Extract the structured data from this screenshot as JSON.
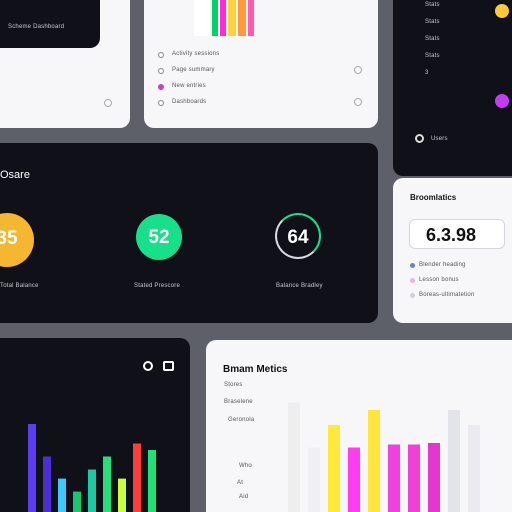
{
  "top_left_card": {
    "caption": "Scheme Dashboard"
  },
  "top_middle_card": {
    "bar_colors": [
      "#ffffff",
      "#00d26a",
      "#ff2bd6",
      "#ffd23c",
      "#ff9a3c",
      "#ff5ab0"
    ],
    "rows": [
      {
        "label": "Activity sessions",
        "icon": "radio-icon",
        "accent": "#888888",
        "action_icon": "chevron-right-icon"
      },
      {
        "label": "Page summary",
        "icon": "radio-icon",
        "accent": "#888888",
        "action_icon": "chevron-right-icon"
      },
      {
        "label": "New entries",
        "icon": "radio-icon",
        "accent": "#d23cc8",
        "action_icon": ""
      },
      {
        "label": "Dashboards",
        "icon": "radio-icon",
        "accent": "#888888",
        "action_icon": "chevron-right-icon"
      }
    ]
  },
  "top_right_card": {
    "list": [
      "Stats",
      "Stats",
      "Stats",
      "Stats",
      "3"
    ],
    "footer_label": "Users",
    "dot_colors": [
      "#ffc83c",
      "#c23cf0"
    ]
  },
  "scores_card": {
    "title": "Osare",
    "gauges": [
      {
        "value": "35",
        "label": "Total Balance",
        "color": "#f5b731"
      },
      {
        "value": "52",
        "label": "Stated Prescore",
        "color": "#18e08a"
      },
      {
        "value": "64",
        "label": "Balance Bradley",
        "color": "#ffffff"
      }
    ]
  },
  "metrics_card": {
    "title": "Broomlatics",
    "value": "6.3.98",
    "legend": [
      {
        "label": "Blender heading",
        "color": "#6f7dd6"
      },
      {
        "label": "Lesson bonus",
        "color": "#e9b5d8"
      },
      {
        "label": "Boreas-ultimatetion",
        "color": "#cfcfd6"
      }
    ]
  },
  "bottom_left_card": {
    "icons": [
      "refresh-icon",
      "export-icon"
    ],
    "bars": [
      {
        "color": "#5b3cf0",
        "value": 0.8
      },
      {
        "color": "#4a2fd2",
        "value": 0.55
      },
      {
        "color": "#3fc8ff",
        "value": 0.38
      },
      {
        "color": "#19c86e",
        "value": 0.28
      },
      {
        "color": "#1ec8a0",
        "value": 0.45
      },
      {
        "color": "#24e07a",
        "value": 0.55
      },
      {
        "color": "#c8ff3c",
        "value": 0.38
      },
      {
        "color": "#ff3c3c",
        "value": 0.65
      },
      {
        "color": "#20e078",
        "value": 0.6
      }
    ]
  },
  "bottom_right_card": {
    "title": "Bmam Metics",
    "legend": [
      "Stores",
      "Braselene",
      "Geronola"
    ],
    "axis": [
      "Who",
      "At",
      "Aid"
    ],
    "bars": [
      {
        "color": "#eeeeee",
        "value": 0.85
      },
      {
        "color": "#f0f0f2",
        "value": 0.55
      },
      {
        "color": "#ffea3c",
        "value": 0.7
      },
      {
        "color": "#ff3cf0",
        "value": 0.55
      },
      {
        "color": "#ffe63c",
        "value": 0.8
      },
      {
        "color": "#f040e0",
        "value": 0.57
      },
      {
        "color": "#f040d8",
        "value": 0.57
      },
      {
        "color": "#e636d0",
        "value": 0.58
      },
      {
        "color": "#e3e3ea",
        "value": 0.8
      },
      {
        "color": "#eaeaf0",
        "value": 0.7
      }
    ]
  }
}
